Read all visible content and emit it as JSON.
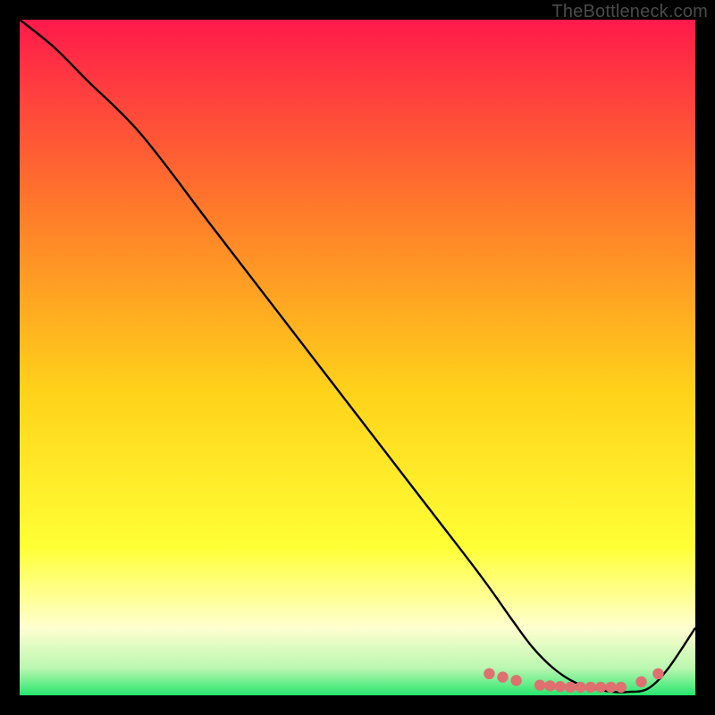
{
  "attribution": "TheBottleneck.com",
  "colors": {
    "top": "#ff1a4b",
    "mid_upper": "#ff7a2a",
    "mid": "#ffd21a",
    "mid_lower": "#ffff35",
    "pale": "#ffffd0",
    "bottom": "#27e66e",
    "black": "#000000",
    "curve": "#000000",
    "dot": "#e07070"
  },
  "chart_data": {
    "type": "line",
    "title": "",
    "xlabel": "",
    "ylabel": "",
    "xlim": [
      0,
      100
    ],
    "ylim": [
      0,
      100
    ],
    "series": [
      {
        "name": "curve",
        "x": [
          0,
          5,
          10,
          18,
          28,
          38,
          48,
          58,
          68,
          73,
          76,
          79,
          82,
          85,
          88,
          90,
          93,
          96,
          100
        ],
        "y": [
          100,
          96,
          91,
          83,
          70,
          57,
          44,
          31,
          18,
          11,
          7,
          4,
          2,
          1,
          0.5,
          0.5,
          1,
          4,
          10
        ]
      }
    ],
    "dots": {
      "name": "highlight",
      "x": [
        69.5,
        71.5,
        73.5,
        77,
        78.5,
        80,
        81.5,
        83,
        84.5,
        86,
        87.5,
        89,
        92,
        94.5
      ],
      "y": [
        3.2,
        2.7,
        2.2,
        1.5,
        1.4,
        1.3,
        1.2,
        1.2,
        1.2,
        1.2,
        1.2,
        1.2,
        2.0,
        3.2
      ]
    }
  }
}
